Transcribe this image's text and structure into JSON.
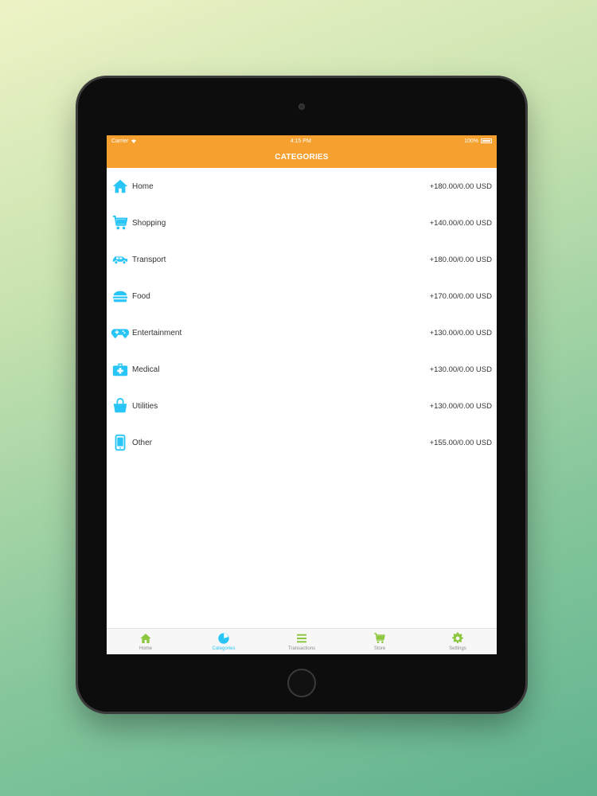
{
  "status_bar": {
    "carrier": "Carrier",
    "time": "4:15 PM",
    "battery": "100%"
  },
  "nav": {
    "title": "CATEGORIES"
  },
  "categories": [
    {
      "label": "Home",
      "amount": "+180.00/0.00 USD",
      "icon": "house-icon"
    },
    {
      "label": "Shopping",
      "amount": "+140.00/0.00 USD",
      "icon": "cart-icon"
    },
    {
      "label": "Transport",
      "amount": "+180.00/0.00 USD",
      "icon": "car-icon"
    },
    {
      "label": "Food",
      "amount": "+170.00/0.00 USD",
      "icon": "burger-icon"
    },
    {
      "label": "Entertainment",
      "amount": "+130.00/0.00 USD",
      "icon": "gamepad-icon"
    },
    {
      "label": "Medical",
      "amount": "+130.00/0.00 USD",
      "icon": "medical-kit-icon"
    },
    {
      "label": "Utilities",
      "amount": "+130.00/0.00 USD",
      "icon": "bag-icon"
    },
    {
      "label": "Other",
      "amount": "+155.00/0.00 USD",
      "icon": "phone-icon"
    }
  ],
  "tabs": [
    {
      "label": "Home",
      "icon": "house-icon",
      "active": false
    },
    {
      "label": "Categories",
      "icon": "pie-chart-icon",
      "active": true
    },
    {
      "label": "Transactions",
      "icon": "list-icon",
      "active": false
    },
    {
      "label": "Store",
      "icon": "cart-icon",
      "active": false
    },
    {
      "label": "Settings",
      "icon": "gear-icon",
      "active": false
    }
  ],
  "colors": {
    "accent": "#f5a02f",
    "icon": "#29c5f6",
    "tab_icon": "#8dc63f"
  }
}
